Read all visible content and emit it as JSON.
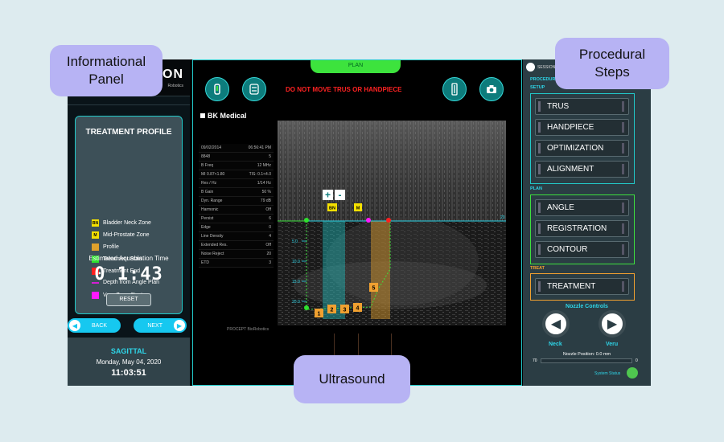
{
  "callouts": {
    "informational": "Informational\nPanel",
    "procedural": "Procedural\nSteps",
    "ultrasound": "Ultrasound"
  },
  "left": {
    "logo_fragment": "ON",
    "logo_sub": "Robotics",
    "profile_title": "TREATMENT PROFILE",
    "legend": [
      {
        "tag": "BN",
        "label": "Bladder Neck Zone",
        "color": "#f5e000"
      },
      {
        "tag": "M",
        "label": "Mid-Prostate Zone",
        "color": "#f5e000"
      },
      {
        "tag": "",
        "label": "Profile",
        "color": "#e0a12c"
      },
      {
        "tag": "",
        "label": "Treatment Start",
        "color": "#2ee02e"
      },
      {
        "tag": "",
        "label": "Treatment End",
        "color": "#ff1f1f"
      },
      {
        "tag": "",
        "label": "Depth from Angle Plan",
        "color": "#d41fd4",
        "line": true
      },
      {
        "tag": "",
        "label": "Veru Zone Start",
        "color": "#ff19ff"
      }
    ],
    "estimated_label": "Estimated Aquablation Time",
    "timer": "0 1:43",
    "reset_label": "RESET",
    "back_label": "BACK",
    "next_label": "NEXT",
    "view": "SAGITTAL",
    "date": "Monday, May 04, 2020",
    "clock": "11:03:51"
  },
  "mid": {
    "plan_tab": "PLAN",
    "warning": "DO NOT MOVE TRUS OR HANDPIECE",
    "vendor": "BK Medical",
    "params": [
      [
        "09/02/2014",
        "06:56:41 PM"
      ],
      [
        "8848",
        "5"
      ],
      [
        "B Freq",
        "12 MHz"
      ],
      [
        "MI 0.87<1.80",
        "TIS: 0.1<4.0"
      ],
      [
        "Res / Hz",
        "1/14 Hz"
      ],
      [
        "B Gain",
        "50 %"
      ],
      [
        "Dyn. Range",
        "79 dB"
      ],
      [
        "Harmonic",
        "Off"
      ],
      [
        "Persist",
        "6"
      ],
      [
        "Edge",
        "0"
      ],
      [
        "Line Density",
        "4"
      ],
      [
        "Extended Res.",
        "Off"
      ],
      [
        "Noise Reject",
        "20"
      ],
      [
        "ETD",
        "3"
      ]
    ],
    "zoom_in": "+",
    "zoom_out": "-",
    "zone_bn": "BN",
    "zone_m": "M",
    "markers": [
      "1",
      "2",
      "3",
      "4",
      "5"
    ],
    "depth_ticks": [
      "5.0",
      "10.0",
      "15.0",
      "20.0"
    ],
    "axis_end": "20",
    "footer": "PROCEPT BioRobotics"
  },
  "right": {
    "session": "SESSION",
    "procedure": "PROCEDURE",
    "setup_label": "SETUP",
    "setup": [
      "TRUS",
      "HANDPIECE",
      "OPTIMIZATION",
      "ALIGNMENT"
    ],
    "plan_label": "PLAN",
    "plan": [
      "ANGLE",
      "REGISTRATION",
      "CONTOUR"
    ],
    "treat_label": "TREAT",
    "treat": [
      "TREATMENT"
    ],
    "nozzle_title": "Nozzle Controls",
    "neck_label": "Neck",
    "veru_label": "Veru",
    "nozzle_position": "Nozzle Position: 0.0 mm",
    "range_min": "70",
    "range_max": "0",
    "system_status": "System Status",
    "colors": {
      "setup": "#22c9c9",
      "plan": "#3ee03e",
      "treat": "#f0a030"
    }
  }
}
